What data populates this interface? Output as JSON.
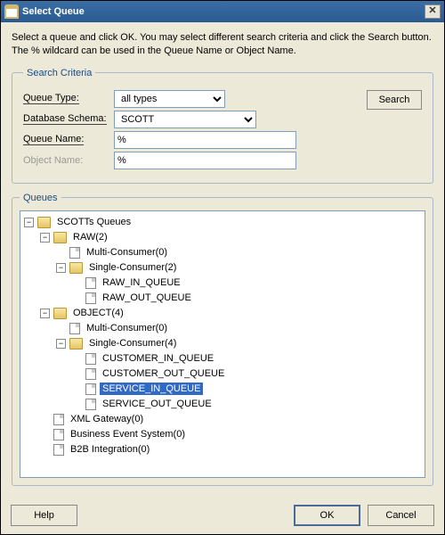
{
  "window": {
    "title": "Select Queue"
  },
  "instructions": "Select a queue and click OK. You may select different search criteria and click the Search button. The % wildcard can be used in the Queue Name or Object Name.",
  "criteria": {
    "legend": "Search Criteria",
    "queueType": {
      "label": "Queue Type:",
      "value": "all types"
    },
    "dbSchema": {
      "label": "Database Schema:",
      "value": "SCOTT"
    },
    "queueName": {
      "label": "Queue Name:",
      "value": "%"
    },
    "objectName": {
      "label": "Object Name:",
      "value": "%"
    },
    "searchBtn": "Search"
  },
  "queues": {
    "legend": "Queues",
    "root": "SCOTTs Queues",
    "raw": {
      "label": "RAW(2)",
      "multi": "Multi-Consumer(0)",
      "single": "Single-Consumer(2)",
      "items": [
        "RAW_IN_QUEUE",
        "RAW_OUT_QUEUE"
      ]
    },
    "object": {
      "label": "OBJECT(4)",
      "multi": "Multi-Consumer(0)",
      "single": "Single-Consumer(4)",
      "items": [
        "CUSTOMER_IN_QUEUE",
        "CUSTOMER_OUT_QUEUE",
        "SERVICE_IN_QUEUE",
        "SERVICE_OUT_QUEUE"
      ]
    },
    "xml": "XML Gateway(0)",
    "bes": "Business Event System(0)",
    "b2b": "B2B Integration(0)",
    "selected": "SERVICE_IN_QUEUE"
  },
  "buttons": {
    "help": "Help",
    "ok": "OK",
    "cancel": "Cancel"
  }
}
